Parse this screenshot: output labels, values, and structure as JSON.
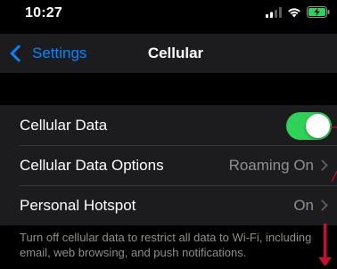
{
  "status_bar": {
    "time": "10:27",
    "icons": [
      "signal-icon",
      "wifi-icon",
      "battery-charging-icon"
    ]
  },
  "nav": {
    "back_label": "Settings",
    "title": "Cellular"
  },
  "rows": [
    {
      "label": "Cellular Data",
      "toggle_on": true
    },
    {
      "label": "Cellular Data Options",
      "value": "Roaming On"
    },
    {
      "label": "Personal Hotspot",
      "value": "On"
    }
  ],
  "footer": {
    "text": "Turn off cellular data to restrict all data to Wi-Fi, including email, web browsing, and push notifications."
  },
  "colors": {
    "accent": "#0a84ff",
    "toggle_on": "#30d158",
    "annotation": "#c8102e",
    "battery": "#30d158"
  }
}
